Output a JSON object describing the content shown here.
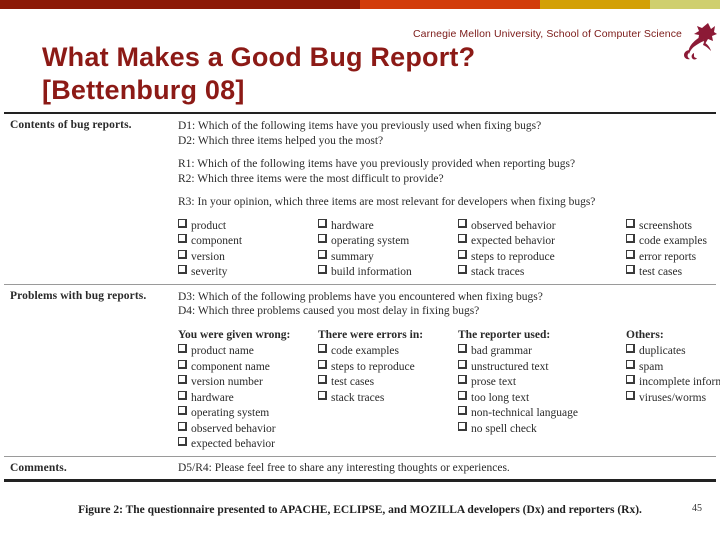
{
  "topbar": {
    "segments": [
      {
        "name": "dark-red",
        "color": "#8C1A07"
      },
      {
        "name": "orange",
        "color": "#D23C0A"
      },
      {
        "name": "gold",
        "color": "#D3A005"
      },
      {
        "name": "pale-olive",
        "color": "#CFCF6E"
      }
    ]
  },
  "header": {
    "organization": "Carnegie Mellon University, School of Computer Science",
    "logo_icon": "cmu-scs-dragon-icon",
    "title_line1": "What Makes a Good Bug Report?",
    "title_line2": "[Bettenburg 08]",
    "title_color": "#8C1A16"
  },
  "figure": {
    "rows": [
      {
        "label": "Contents of bug reports.",
        "questions_group1": [
          "D1: Which of the following items have you previously used when fixing bugs?",
          "D2: Which three items helped you the most?"
        ],
        "questions_group2": [
          "R1: Which of the following items have you previously provided when reporting bugs?",
          "R2: Which three items were the most difficult to provide?"
        ],
        "questions_group3": [
          "R3: In your opinion, which three items are most relevant for developers when fixing bugs?"
        ],
        "option_columns": [
          {
            "header": "",
            "options": [
              "product",
              "component",
              "version",
              "severity"
            ]
          },
          {
            "header": "",
            "options": [
              "hardware",
              "operating system",
              "summary",
              "build information"
            ]
          },
          {
            "header": "",
            "options": [
              "observed behavior",
              "expected behavior",
              "steps to reproduce",
              "stack traces"
            ]
          },
          {
            "header": "",
            "options": [
              "screenshots",
              "code examples",
              "error reports",
              "test cases"
            ]
          }
        ]
      },
      {
        "label": "Problems with bug reports.",
        "questions_group1": [
          "D3: Which of the following problems have you encountered when fixing bugs?",
          "D4: Which three problems caused you most delay in fixing bugs?"
        ],
        "option_columns": [
          {
            "header": "You were given wrong:",
            "options": [
              "product name",
              "component name",
              "version number",
              "hardware",
              "operating system",
              "observed behavior",
              "expected behavior"
            ]
          },
          {
            "header": "There were errors in:",
            "options": [
              "code examples",
              "steps to reproduce",
              "test cases",
              "stack traces"
            ]
          },
          {
            "header": "The reporter used:",
            "options": [
              "bad grammar",
              "unstructured text",
              "prose text",
              "too long text",
              "non-technical language",
              "no spell check"
            ]
          },
          {
            "header": "Others:",
            "options": [
              "duplicates",
              "spam",
              "incomplete information",
              "viruses/worms"
            ]
          }
        ]
      },
      {
        "label": "Comments.",
        "questions_group1": [
          "D5/R4: Please feel free to share any interesting thoughts or experiences."
        ]
      }
    ],
    "caption": "Figure 2: The questionnaire presented to APACHE, ECLIPSE, and MOZILLA developers (Dx) and reporters (Rx)."
  },
  "page_number": "45"
}
